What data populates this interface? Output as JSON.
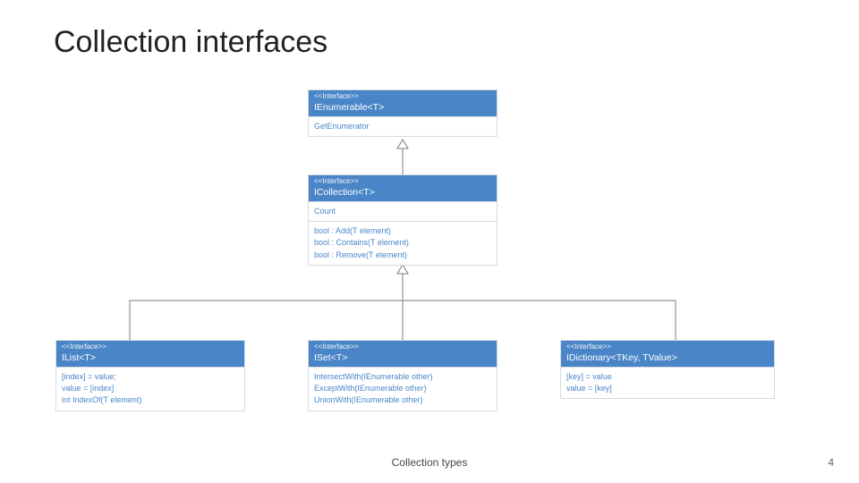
{
  "title": "Collection interfaces",
  "footer": {
    "center": "Collection types",
    "page": "4"
  },
  "stereotype": "<<Interface>>",
  "boxes": {
    "ienumerable": {
      "name": "IEnumerable<T>",
      "members": [
        "GetEnumerator"
      ]
    },
    "icollection": {
      "name": "ICollection<T>",
      "props": [
        "Count"
      ],
      "members": [
        "bool : Add(T element)",
        "bool : Contains(T element)",
        "bool : Remove(T element)"
      ]
    },
    "ilist": {
      "name": "IList<T>",
      "members": [
        "[index] = value;",
        "value = [index]",
        "int IndexOf(T element)"
      ]
    },
    "iset": {
      "name": "ISet<T>",
      "members": [
        "IntersectWith(IEnumerable other)",
        "ExceptWith(IEnumerable other)",
        "UnionWith(IEnumerable other)"
      ]
    },
    "idict": {
      "name": "IDictionary<TKey, TValue>",
      "members": [
        "[key] = value",
        "value = [key]"
      ]
    }
  }
}
